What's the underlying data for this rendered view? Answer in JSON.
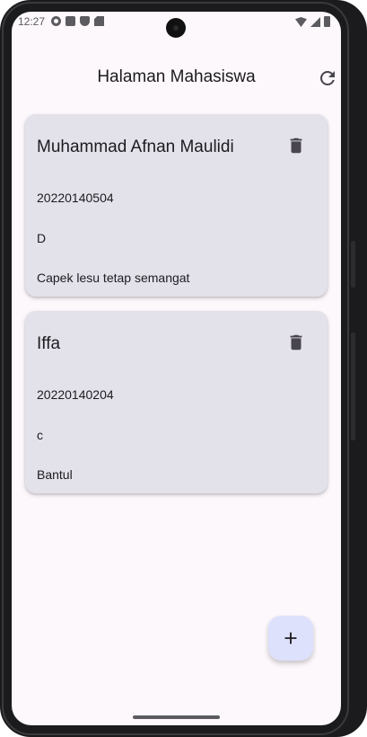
{
  "status_bar": {
    "time": "12:27",
    "left_icons": [
      "gear-icon",
      "a-icon",
      "shield-icon",
      "sd-card-icon"
    ],
    "right_icons": [
      "wifi-icon",
      "signal-icon",
      "battery-icon"
    ]
  },
  "app_bar": {
    "title": "Halaman Mahasiswa",
    "refresh_icon": "refresh-icon"
  },
  "students": [
    {
      "name": "Muhammad Afnan Maulidi",
      "nim": "20220140504",
      "class": "D",
      "address": "Capek lesu tetap semangat"
    },
    {
      "name": "Iffa",
      "nim": "20220140204",
      "class": "c",
      "address": "Bantul"
    }
  ],
  "fab": {
    "icon": "plus-icon"
  },
  "colors": {
    "background": "#fdf8fc",
    "card": "#e3e2ea",
    "fab": "#dde1fb",
    "text": "#1d1b20",
    "icon": "#49454f"
  }
}
